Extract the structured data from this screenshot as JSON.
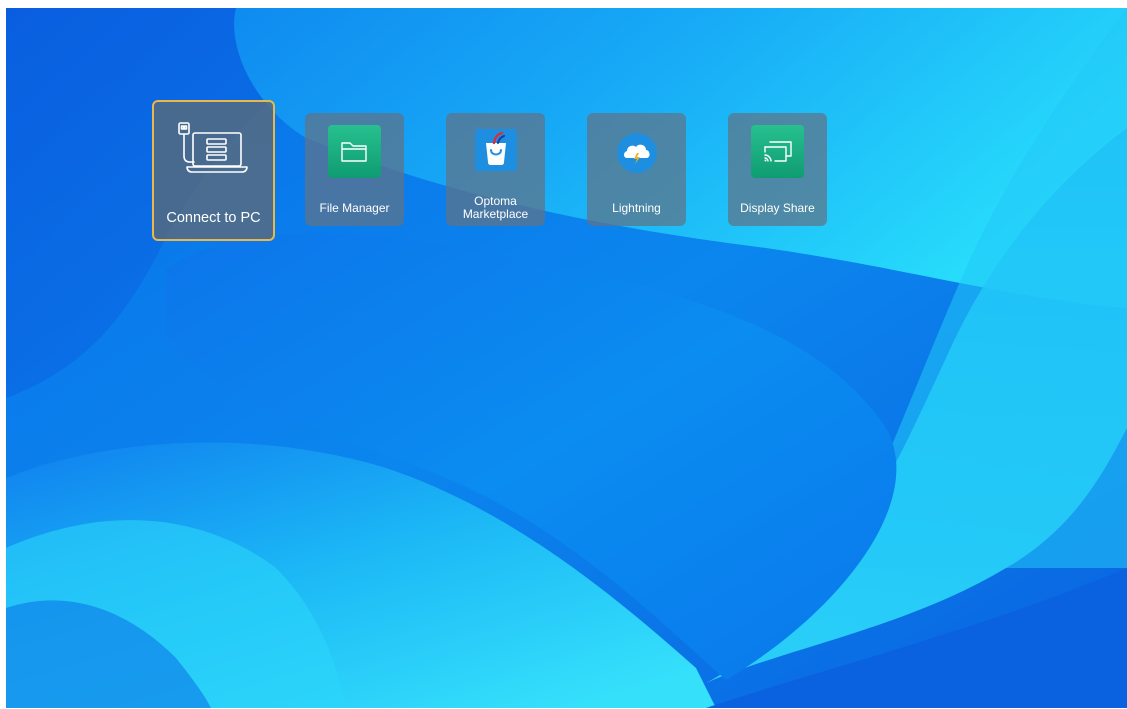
{
  "apps": [
    {
      "label": "Connect to PC",
      "icon": "connect-to-pc-icon",
      "focused": true
    },
    {
      "label": "File Manager",
      "icon": "folder-icon",
      "focused": false
    },
    {
      "label": "Optoma\nMarketplace",
      "icon": "shopping-bag-icon",
      "focused": false
    },
    {
      "label": "Lightning",
      "icon": "cloud-lightning-icon",
      "focused": false
    },
    {
      "label": "Display Share",
      "icon": "screen-cast-icon",
      "focused": false
    }
  ],
  "colors": {
    "focus_border": "#e8b84a",
    "tile_background": "#5f7387",
    "green_icon": "#1fa97e",
    "blue_icon": "#1e8fe0"
  }
}
